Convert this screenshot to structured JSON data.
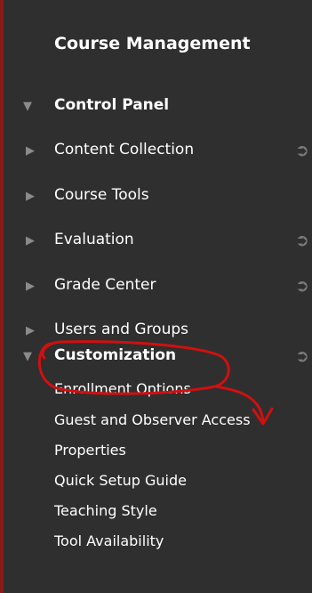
{
  "heading": "Course Management",
  "control_panel": {
    "label": "Control Panel"
  },
  "items": [
    {
      "label": "Content Collection"
    },
    {
      "label": "Course Tools"
    },
    {
      "label": "Evaluation"
    },
    {
      "label": "Grade Center"
    },
    {
      "label": "Users and Groups"
    }
  ],
  "customization": {
    "label": "Customization",
    "subitems": [
      {
        "label": "Enrollment Options"
      },
      {
        "label": "Guest and Observer Access"
      },
      {
        "label": "Properties"
      },
      {
        "label": "Quick Setup Guide"
      },
      {
        "label": "Teaching Style"
      },
      {
        "label": "Tool Availability"
      }
    ]
  },
  "icons": {
    "expanded": "triangle-down-icon",
    "collapsed": "triangle-right-icon",
    "go": "circle-arrow-right-icon"
  },
  "colors": {
    "panel_bg": "#2f2f2f",
    "border": "#8a1a1a",
    "annotation": "#d01010"
  }
}
